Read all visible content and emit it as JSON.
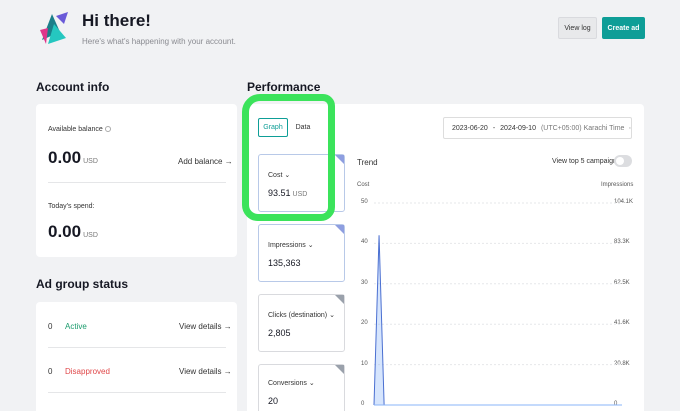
{
  "header": {
    "title": "Hi there!",
    "subtitle": "Here's what's happening with your account.",
    "view_log": "View log",
    "create_ad": "Create ad"
  },
  "account_info": {
    "title": "Account info",
    "available_balance_label": "Available balance",
    "available_balance": "0.00",
    "currency": "USD",
    "add_balance": "Add balance",
    "todays_spend_label": "Today's spend:",
    "todays_spend": "0.00"
  },
  "ad_group_status": {
    "title": "Ad group status",
    "rows": [
      {
        "count": "0",
        "label": "Active",
        "details": "View details"
      },
      {
        "count": "0",
        "label": "Disapproved",
        "details": "View details"
      }
    ]
  },
  "performance": {
    "title": "Performance",
    "tabs": [
      "Graph",
      "Data"
    ],
    "date_start": "2023-06-20",
    "date_sep": "-",
    "date_end": "2024-09-10",
    "timezone": "(UTC+05:00) Karachi Time",
    "metrics": [
      {
        "label": "Cost",
        "value": "93.51",
        "unit": "USD"
      },
      {
        "label": "Impressions",
        "value": "135,363"
      },
      {
        "label": "Clicks (destination)",
        "value": "2,805"
      },
      {
        "label": "Conversions",
        "value": "20"
      }
    ],
    "trend_title": "Trend",
    "top5_label": "View top 5 campaigns"
  },
  "chart_data": {
    "type": "line",
    "y_left_label": "Cost",
    "y_right_label": "Impressions",
    "y_left_ticks": [
      "50",
      "40",
      "30",
      "20",
      "10",
      "0"
    ],
    "y_right_ticks": [
      "104.1K",
      "83.3K",
      "62.5K",
      "41.6K",
      "20.8K",
      "0"
    ],
    "ylim_left": [
      0,
      50
    ],
    "ylim_right": [
      0,
      104100
    ],
    "series": [
      {
        "name": "Cost",
        "values": [
          0,
          42,
          0,
          0,
          0,
          0,
          0,
          0,
          0,
          0,
          0,
          0,
          0,
          0,
          0,
          0,
          0,
          0,
          0,
          0,
          0,
          0,
          0,
          0,
          0,
          0,
          0,
          0,
          0,
          0,
          0,
          0,
          0,
          0,
          0,
          0,
          0,
          0,
          0,
          0,
          0,
          0,
          0,
          0,
          0,
          0,
          0,
          0,
          0,
          0
        ]
      },
      {
        "name": "Impressions",
        "values": [
          0,
          0,
          0,
          0,
          0,
          0,
          0,
          0,
          0,
          0,
          0,
          0,
          0,
          0,
          0,
          0,
          0,
          0,
          0,
          0,
          0,
          0,
          0,
          0,
          0,
          0,
          0,
          0,
          0,
          0,
          0,
          0,
          0,
          0,
          0,
          0,
          0,
          0,
          0,
          0,
          0,
          0,
          0,
          0,
          0,
          0,
          0,
          0,
          0,
          0
        ]
      }
    ],
    "colors": {
      "cost": "#4a6fd1",
      "impressions": "#8ab4f8"
    }
  },
  "colors": {
    "accent": "#0e9e97",
    "active": "#1a9b6c",
    "disapproved": "#e0484a",
    "highlight": "#3be35b"
  }
}
